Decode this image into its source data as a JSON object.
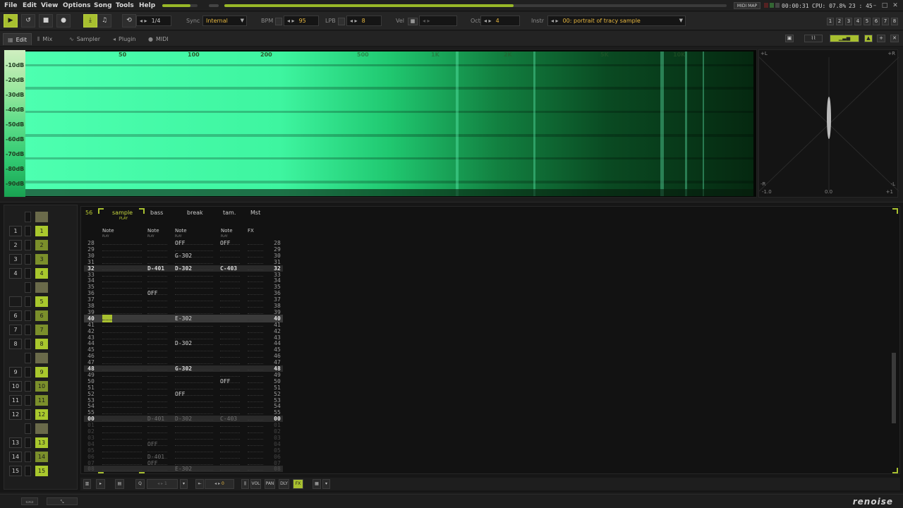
{
  "menu": [
    "File",
    "Edit",
    "View",
    "Options",
    "Song",
    "Tools",
    "Help"
  ],
  "status": {
    "midi_map": "MIDI MAP",
    "time": "00:00:31",
    "cpu": "CPU: 07.8%",
    "clock": "23 : 45",
    "view_buttons": [
      "1",
      "2",
      "3",
      "4",
      "5",
      "6",
      "7",
      "8"
    ]
  },
  "transport": {
    "play_icon": "play-icon",
    "loop_icon": "loop-icon",
    "stop_icon": "stop-icon",
    "record_icon": "record-icon",
    "pattern_step": "1/4",
    "sync_label": "Sync",
    "sync_value": "Internal",
    "bpm_label": "BPM",
    "bpm_value": "95",
    "lpb_label": "LPB",
    "lpb_value": "8",
    "vel_label": "Vel",
    "oct_label": "Oct",
    "oct_value": "4",
    "instr_label": "Instr",
    "instr_value": "00: portrait of tracy sample"
  },
  "tabs": [
    {
      "label": "Edit",
      "icon": "grid-icon"
    },
    {
      "label": "Mix",
      "icon": "mixer-icon"
    },
    {
      "label": "Sampler",
      "icon": "waveform-icon"
    },
    {
      "label": "Plugin",
      "icon": "plug-icon"
    },
    {
      "label": "MIDI",
      "icon": "midi-icon"
    }
  ],
  "spectrum": {
    "db_labels": [
      "-10dB",
      "-20dB",
      "-30dB",
      "-40dB",
      "-50dB",
      "-60dB",
      "-70dB",
      "-80dB",
      "-90dB"
    ],
    "freq_labels": [
      "50",
      "100",
      "200",
      "500",
      "1K",
      "2K",
      "5K",
      "10K"
    ]
  },
  "scope": {
    "top_left": "+L",
    "top_right": "+R",
    "bottom_left": "-R",
    "bottom_right": "-L",
    "x_min": "-1.0",
    "x_mid": "0.0",
    "x_max": "+1"
  },
  "matrix": {
    "rows": [
      {
        "num": "",
        "slot": "",
        "state": "empty"
      },
      {
        "num": "1",
        "slot": "1",
        "state": "lit"
      },
      {
        "num": "2",
        "slot": "2",
        "state": "dim"
      },
      {
        "num": "3",
        "slot": "3",
        "state": "dim"
      },
      {
        "num": "4",
        "slot": "4",
        "state": "lit"
      },
      {
        "num": "",
        "slot": "",
        "state": "empty"
      },
      {
        "num": "",
        "slot": "5",
        "state": "lit"
      },
      {
        "num": "6",
        "slot": "6",
        "state": "dim"
      },
      {
        "num": "7",
        "slot": "7",
        "state": "dim"
      },
      {
        "num": "8",
        "slot": "8",
        "state": "lit"
      },
      {
        "num": "",
        "slot": "",
        "state": "empty"
      },
      {
        "num": "9",
        "slot": "9",
        "state": "lit"
      },
      {
        "num": "10",
        "slot": "10",
        "state": "dim"
      },
      {
        "num": "11",
        "slot": "11",
        "state": "dim"
      },
      {
        "num": "12",
        "slot": "12",
        "state": "lit"
      },
      {
        "num": "",
        "slot": "",
        "state": "empty"
      },
      {
        "num": "13",
        "slot": "13",
        "state": "lit"
      },
      {
        "num": "14",
        "slot": "14",
        "state": "dim"
      },
      {
        "num": "15",
        "slot": "15",
        "state": "lit"
      }
    ]
  },
  "pattern": {
    "pattern_number": "56",
    "tracks": [
      {
        "name": "sample",
        "sub": "PLAY",
        "col": "Note",
        "colsub": "PLAY"
      },
      {
        "name": "bass",
        "sub": "",
        "col": "Note",
        "colsub": "PLAY"
      },
      {
        "name": "break",
        "sub": "",
        "col": "Note",
        "colsub": "PLAY"
      },
      {
        "name": "tam.",
        "sub": "",
        "col": "Note",
        "colsub": "PLAY"
      },
      {
        "name": "Mst",
        "sub": "",
        "col": "FX",
        "colsub": ""
      }
    ],
    "line_numbers": [
      "28",
      "29",
      "30",
      "31",
      "32",
      "33",
      "34",
      "35",
      "36",
      "37",
      "38",
      "39",
      "40",
      "41",
      "42",
      "43",
      "44",
      "45",
      "46",
      "47",
      "48",
      "49",
      "50",
      "51",
      "52",
      "53",
      "54",
      "55",
      "00",
      "01",
      "02",
      "03",
      "04",
      "05",
      "06",
      "07",
      "08"
    ],
    "cells": [
      {
        "line": 0,
        "track": 2,
        "text": "OFF",
        "dim": false
      },
      {
        "line": 0,
        "track": 3,
        "text": "OFF",
        "dim": false
      },
      {
        "line": 2,
        "track": 2,
        "text": "G-302",
        "dim": false
      },
      {
        "line": 4,
        "track": 1,
        "text": "D-401",
        "dim": false
      },
      {
        "line": 4,
        "track": 2,
        "text": "D-302",
        "dim": false
      },
      {
        "line": 4,
        "track": 3,
        "text": "C-403",
        "dim": false
      },
      {
        "line": 8,
        "track": 1,
        "text": "OFF",
        "dim": false
      },
      {
        "line": 12,
        "track": 2,
        "text": "E-302",
        "dim": false
      },
      {
        "line": 16,
        "track": 2,
        "text": "D-302",
        "dim": false
      },
      {
        "line": 20,
        "track": 2,
        "text": "G-302",
        "dim": false
      },
      {
        "line": 22,
        "track": 3,
        "text": "OFF",
        "dim": false
      },
      {
        "line": 24,
        "track": 2,
        "text": "OFF",
        "dim": false
      },
      {
        "line": 28,
        "track": 1,
        "text": "D-401",
        "dim": true
      },
      {
        "line": 28,
        "track": 2,
        "text": "D-302",
        "dim": true
      },
      {
        "line": 28,
        "track": 3,
        "text": "C-403",
        "dim": true
      },
      {
        "line": 32,
        "track": 1,
        "text": "OFF",
        "dim": true
      },
      {
        "line": 34,
        "track": 1,
        "text": "D-401",
        "dim": true
      },
      {
        "line": 35,
        "track": 1,
        "text": "OFF",
        "dim": true
      },
      {
        "line": 36,
        "track": 2,
        "text": "E-302",
        "dim": true
      }
    ]
  },
  "bottombar": {
    "step_value": "1",
    "edit_step_value": "0",
    "vol_label": "VOL",
    "pan_label": "PAN",
    "dly_label": "DLY",
    "fx_label": "FX"
  },
  "logo": "renoise"
}
